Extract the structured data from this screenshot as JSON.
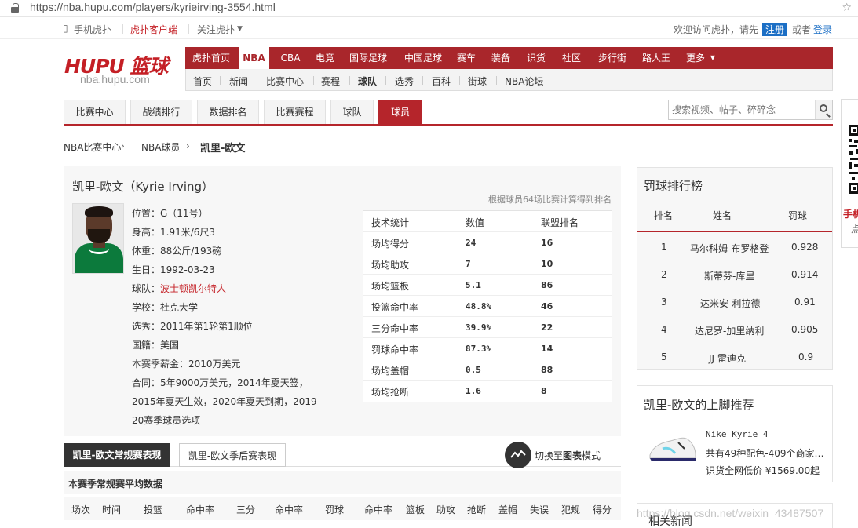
{
  "browser": {
    "url": "https://nba.hupu.com/players/kyrieirving-3554.html"
  },
  "topbar": {
    "mobile": "手机虎扑",
    "client": "虎扑客户端",
    "follow": "关注虎扑",
    "welcome": "欢迎访问虎扑，请先",
    "register": "注册",
    "or": "或者",
    "login": "登录"
  },
  "logo": {
    "main": "HUPU 篮球",
    "domain": "nba.hupu.com"
  },
  "main_nav": [
    "虎扑首页",
    "NBA",
    "CBA",
    "电竞",
    "国际足球",
    "中国足球",
    "赛车",
    "装备",
    "识货",
    "社区",
    "步行街",
    "路人王",
    "更多"
  ],
  "sub_nav": [
    "首页",
    "新闻",
    "比赛中心",
    "赛程",
    "球队",
    "选秀",
    "百科",
    "街球",
    "NBA论坛"
  ],
  "tabs": [
    "比赛中心",
    "战绩排行",
    "数据排名",
    "比赛赛程",
    "球队",
    "球员"
  ],
  "search": {
    "placeholder": "搜索视频、帖子、碎碎念"
  },
  "breadcrumb": [
    "NBA比赛中心",
    "NBA球员",
    "凯里-欧文"
  ],
  "player": {
    "name": "凯里-欧文（Kyrie Irving）",
    "rank_note": "根据球员64场比赛计算得到排名",
    "position": "位置：G（11号）",
    "height": "身高：1.91米/6尺3",
    "weight": "体重：88公斤/193磅",
    "birthday": "生日：1992-03-23",
    "team_label": "球队：",
    "team": "波士顿凯尔特人",
    "school": "学校：杜克大学",
    "draft": "选秀：2011年第1轮第1顺位",
    "nation": "国籍：美国",
    "salary": "本赛季薪金：2010万美元",
    "contract": "合同：5年9000万美元，2014年夏天签，2015年夏天生效，2020年夏天到期，2019-20赛季球员选项"
  },
  "stats_table": {
    "headers": [
      "技术统计",
      "数值",
      "联盟排名"
    ],
    "rows": [
      [
        "场均得分",
        "24",
        "16"
      ],
      [
        "场均助攻",
        "7",
        "10"
      ],
      [
        "场均篮板",
        "5.1",
        "86"
      ],
      [
        "投篮命中率",
        "48.8%",
        "46"
      ],
      [
        "三分命中率",
        "39.9%",
        "22"
      ],
      [
        "罚球命中率",
        "87.3%",
        "14"
      ],
      [
        "场均盖帽",
        "0.5",
        "88"
      ],
      [
        "场均抢断",
        "1.6",
        "8"
      ]
    ]
  },
  "season_tabs": {
    "regular": "凯里-欧文常规赛表现",
    "playoff": "凯里-欧文季后赛表现",
    "chart_prefix": "切换至",
    "chart_bold": "图表",
    "chart_suffix": "模式"
  },
  "avg_title": "本赛季常规赛平均数据",
  "avg_columns": [
    "场次",
    "时间",
    "投篮",
    "命中率",
    "三分",
    "命中率",
    "罚球",
    "命中率",
    "篮板",
    "助攻",
    "抢断",
    "盖帽",
    "失误",
    "犯规",
    "得分"
  ],
  "ft_rank": {
    "title": "罚球排行榜",
    "headers": [
      "排名",
      "姓名",
      "罚球"
    ],
    "rows": [
      [
        "1",
        "马尔科姆-布罗格登",
        "0.928"
      ],
      [
        "2",
        "斯蒂芬-库里",
        "0.914"
      ],
      [
        "3",
        "达米安-利拉德",
        "0.91"
      ],
      [
        "4",
        "达尼罗-加里纳利",
        "0.905"
      ],
      [
        "5",
        "JJ-雷迪克",
        "0.9"
      ]
    ]
  },
  "shoe": {
    "title": "凯里-欧文的上脚推荐",
    "name": "Nike Kyrie 4",
    "desc": "共有49种配色-409个商家在售",
    "price": "识货全网低价 ¥1569.00起"
  },
  "news": {
    "title": "相关新闻"
  },
  "watermark": "https://blog.csdn.net/weixin_43487507",
  "qr_side": {
    "label": "手机",
    "sub": "点"
  },
  "colors": {
    "brand_red": "#a9262b",
    "tab_red": "#b5252b",
    "link_blue": "#1c6fc5"
  }
}
